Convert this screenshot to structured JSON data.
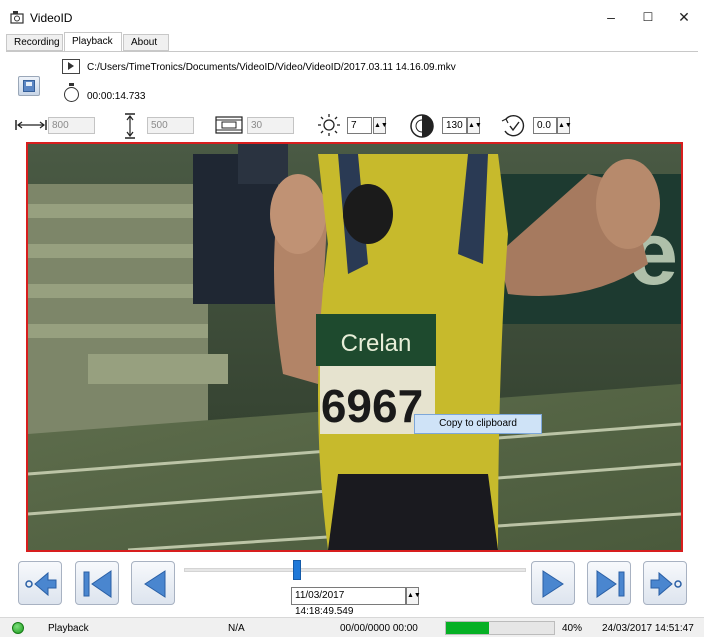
{
  "window": {
    "title": "VideoID",
    "icons": {
      "app": "camera-icon",
      "minimize": "minimize-icon",
      "maximize": "maximize-icon",
      "close": "close-icon"
    },
    "controls": {
      "minimize": "–",
      "maximize": "☐",
      "close": "✕"
    }
  },
  "tabs": [
    {
      "label": "Recording",
      "active": false
    },
    {
      "label": "Playback",
      "active": true
    },
    {
      "label": "About",
      "active": false
    }
  ],
  "file": {
    "path": "C:/Users/TimeTronics/Documents/VideoID/Video/VideoID/2017.03.11 14.16.09.mkv",
    "duration": "00:00:14.733"
  },
  "params": {
    "width": {
      "icon": "width-icon",
      "value": "800"
    },
    "height": {
      "icon": "height-icon",
      "value": "500"
    },
    "fps": {
      "icon": "film-icon",
      "value": "30"
    },
    "brightness": {
      "icon": "brightness-icon",
      "value": "7"
    },
    "contrast": {
      "icon": "contrast-icon",
      "value": "130"
    },
    "gamma": {
      "icon": "gamma-icon",
      "value": "0.0"
    }
  },
  "video": {
    "bib_sponsor": "Crelan",
    "bib_number": "6967",
    "border_color": "#d81e1e"
  },
  "context_menu": {
    "copy_label": "Copy to clipboard"
  },
  "playback": {
    "position": 0.33,
    "datetime": "11/03/2017 14:18:49.549",
    "buttons": [
      "go-start-icon",
      "first-frame-icon",
      "step-back-icon",
      "step-forward-icon",
      "last-frame-icon",
      "go-end-icon"
    ]
  },
  "status": {
    "state": "Playback",
    "na": "N/A",
    "last_time": "00/00/0000 00:00",
    "progress": 0.4,
    "progress_text": "40%",
    "clock": "24/03/2017 14:51:47",
    "accent_green": "#06b025",
    "accent_blue": "#1f78d8"
  }
}
